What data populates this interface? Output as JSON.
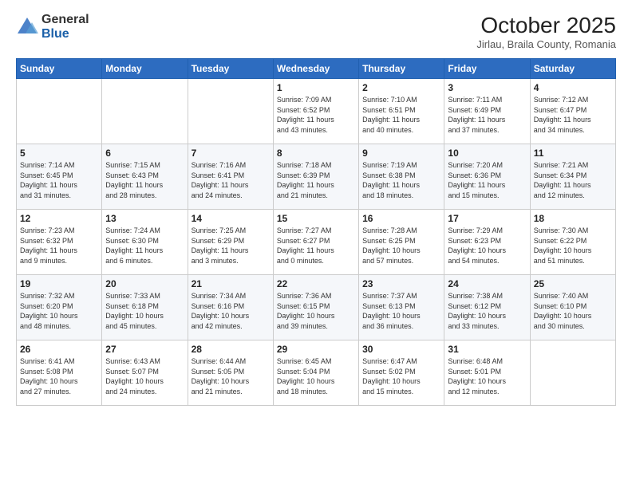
{
  "logo": {
    "general": "General",
    "blue": "Blue"
  },
  "header": {
    "month": "October 2025",
    "location": "Jirlau, Braila County, Romania"
  },
  "weekdays": [
    "Sunday",
    "Monday",
    "Tuesday",
    "Wednesday",
    "Thursday",
    "Friday",
    "Saturday"
  ],
  "weeks": [
    [
      {
        "day": "",
        "info": ""
      },
      {
        "day": "",
        "info": ""
      },
      {
        "day": "",
        "info": ""
      },
      {
        "day": "1",
        "info": "Sunrise: 7:09 AM\nSunset: 6:52 PM\nDaylight: 11 hours\nand 43 minutes."
      },
      {
        "day": "2",
        "info": "Sunrise: 7:10 AM\nSunset: 6:51 PM\nDaylight: 11 hours\nand 40 minutes."
      },
      {
        "day": "3",
        "info": "Sunrise: 7:11 AM\nSunset: 6:49 PM\nDaylight: 11 hours\nand 37 minutes."
      },
      {
        "day": "4",
        "info": "Sunrise: 7:12 AM\nSunset: 6:47 PM\nDaylight: 11 hours\nand 34 minutes."
      }
    ],
    [
      {
        "day": "5",
        "info": "Sunrise: 7:14 AM\nSunset: 6:45 PM\nDaylight: 11 hours\nand 31 minutes."
      },
      {
        "day": "6",
        "info": "Sunrise: 7:15 AM\nSunset: 6:43 PM\nDaylight: 11 hours\nand 28 minutes."
      },
      {
        "day": "7",
        "info": "Sunrise: 7:16 AM\nSunset: 6:41 PM\nDaylight: 11 hours\nand 24 minutes."
      },
      {
        "day": "8",
        "info": "Sunrise: 7:18 AM\nSunset: 6:39 PM\nDaylight: 11 hours\nand 21 minutes."
      },
      {
        "day": "9",
        "info": "Sunrise: 7:19 AM\nSunset: 6:38 PM\nDaylight: 11 hours\nand 18 minutes."
      },
      {
        "day": "10",
        "info": "Sunrise: 7:20 AM\nSunset: 6:36 PM\nDaylight: 11 hours\nand 15 minutes."
      },
      {
        "day": "11",
        "info": "Sunrise: 7:21 AM\nSunset: 6:34 PM\nDaylight: 11 hours\nand 12 minutes."
      }
    ],
    [
      {
        "day": "12",
        "info": "Sunrise: 7:23 AM\nSunset: 6:32 PM\nDaylight: 11 hours\nand 9 minutes."
      },
      {
        "day": "13",
        "info": "Sunrise: 7:24 AM\nSunset: 6:30 PM\nDaylight: 11 hours\nand 6 minutes."
      },
      {
        "day": "14",
        "info": "Sunrise: 7:25 AM\nSunset: 6:29 PM\nDaylight: 11 hours\nand 3 minutes."
      },
      {
        "day": "15",
        "info": "Sunrise: 7:27 AM\nSunset: 6:27 PM\nDaylight: 11 hours\nand 0 minutes."
      },
      {
        "day": "16",
        "info": "Sunrise: 7:28 AM\nSunset: 6:25 PM\nDaylight: 10 hours\nand 57 minutes."
      },
      {
        "day": "17",
        "info": "Sunrise: 7:29 AM\nSunset: 6:23 PM\nDaylight: 10 hours\nand 54 minutes."
      },
      {
        "day": "18",
        "info": "Sunrise: 7:30 AM\nSunset: 6:22 PM\nDaylight: 10 hours\nand 51 minutes."
      }
    ],
    [
      {
        "day": "19",
        "info": "Sunrise: 7:32 AM\nSunset: 6:20 PM\nDaylight: 10 hours\nand 48 minutes."
      },
      {
        "day": "20",
        "info": "Sunrise: 7:33 AM\nSunset: 6:18 PM\nDaylight: 10 hours\nand 45 minutes."
      },
      {
        "day": "21",
        "info": "Sunrise: 7:34 AM\nSunset: 6:16 PM\nDaylight: 10 hours\nand 42 minutes."
      },
      {
        "day": "22",
        "info": "Sunrise: 7:36 AM\nSunset: 6:15 PM\nDaylight: 10 hours\nand 39 minutes."
      },
      {
        "day": "23",
        "info": "Sunrise: 7:37 AM\nSunset: 6:13 PM\nDaylight: 10 hours\nand 36 minutes."
      },
      {
        "day": "24",
        "info": "Sunrise: 7:38 AM\nSunset: 6:12 PM\nDaylight: 10 hours\nand 33 minutes."
      },
      {
        "day": "25",
        "info": "Sunrise: 7:40 AM\nSunset: 6:10 PM\nDaylight: 10 hours\nand 30 minutes."
      }
    ],
    [
      {
        "day": "26",
        "info": "Sunrise: 6:41 AM\nSunset: 5:08 PM\nDaylight: 10 hours\nand 27 minutes."
      },
      {
        "day": "27",
        "info": "Sunrise: 6:43 AM\nSunset: 5:07 PM\nDaylight: 10 hours\nand 24 minutes."
      },
      {
        "day": "28",
        "info": "Sunrise: 6:44 AM\nSunset: 5:05 PM\nDaylight: 10 hours\nand 21 minutes."
      },
      {
        "day": "29",
        "info": "Sunrise: 6:45 AM\nSunset: 5:04 PM\nDaylight: 10 hours\nand 18 minutes."
      },
      {
        "day": "30",
        "info": "Sunrise: 6:47 AM\nSunset: 5:02 PM\nDaylight: 10 hours\nand 15 minutes."
      },
      {
        "day": "31",
        "info": "Sunrise: 6:48 AM\nSunset: 5:01 PM\nDaylight: 10 hours\nand 12 minutes."
      },
      {
        "day": "",
        "info": ""
      }
    ]
  ]
}
